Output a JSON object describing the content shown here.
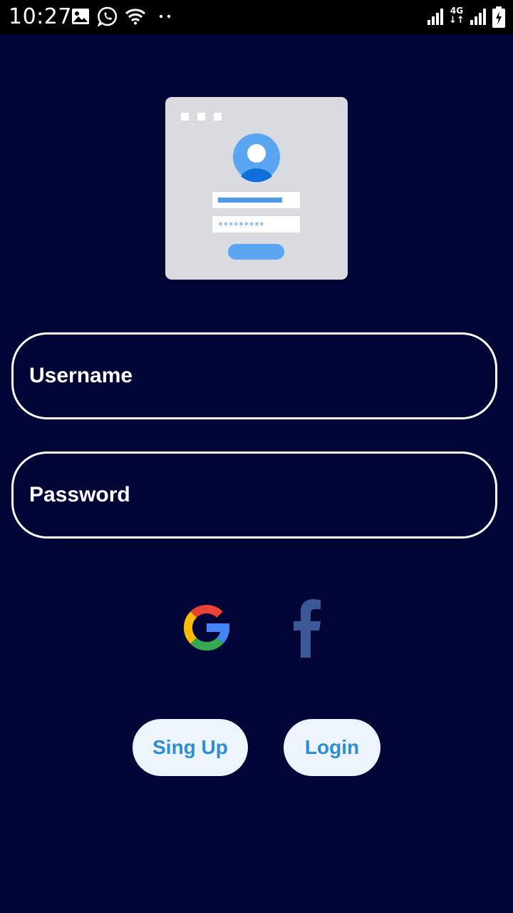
{
  "status_bar": {
    "time": "10:27",
    "network": "4G",
    "icons": [
      "gallery-icon",
      "whatsapp-icon",
      "wifi-icon",
      "more-dots-icon",
      "signal-icon",
      "network-4g-icon",
      "signal-icon",
      "battery-charging-icon"
    ]
  },
  "illustration": {
    "icon": "login-form-illustration",
    "password_mask": "*********"
  },
  "form": {
    "username_label": "Username",
    "password_label": "Password"
  },
  "social": {
    "google_icon": "google-icon",
    "facebook_icon": "facebook-icon"
  },
  "buttons": {
    "signup_label": "Sing Up",
    "login_label": "Login"
  },
  "colors": {
    "background": "#000535",
    "field_border": "#ffffff",
    "button_background": "#eef4fb",
    "button_text": "#2b8ed6",
    "facebook_blue": "#3b5998"
  }
}
